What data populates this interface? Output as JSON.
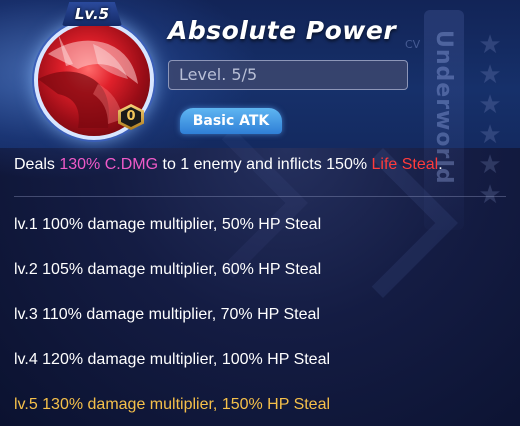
{
  "skill": {
    "portrait_level": "Lv.5",
    "rank": "0",
    "name": "Absolute Power",
    "level_text": "Level. 5/5",
    "type": "Basic ATK"
  },
  "description": {
    "part1": "Deals ",
    "highlight1": "130% C.DMG",
    "part2": " to 1 enemy and inflicts 150% ",
    "highlight2": "Life Steal",
    "part3": "."
  },
  "level_rows": [
    {
      "text": "lv.1 100% damage multiplier, 50% HP Steal"
    },
    {
      "text": "lv.2 105% damage multiplier, 60% HP Steal"
    },
    {
      "text": "lv.3 110% damage multiplier, 70% HP Steal"
    },
    {
      "text": "lv.4 120% damage multiplier, 100% HP Steal"
    },
    {
      "text": "lv.5 130% damage multiplier, 150% HP Steal"
    }
  ],
  "background": {
    "vertical_text": "Underworld",
    "cv_text": "CV"
  },
  "colors": {
    "highlight_pink": "#f05ac8",
    "highlight_red": "#ff3b3b",
    "current_level": "#f5c04a",
    "tag_blue": "#2f7fd6"
  }
}
